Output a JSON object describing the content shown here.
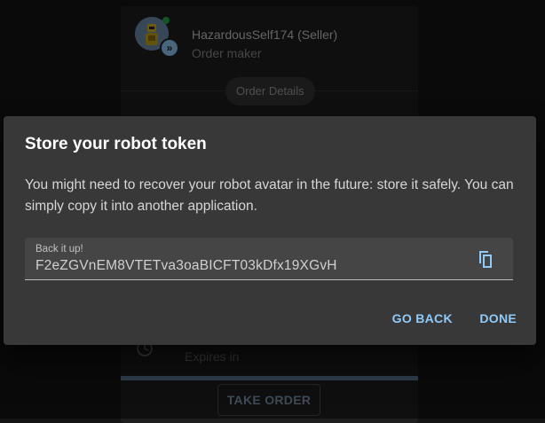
{
  "order": {
    "seller_name": "HazardousSelf174 (Seller)",
    "seller_role": "Order maker",
    "details_chip": "Order Details",
    "expires_label": "Expires in",
    "progress_fraction": 1.0,
    "take_order_label": "TAKE ORDER"
  },
  "dialog": {
    "title": "Store your robot token",
    "body": "You might need to recover your robot avatar in the future: store it safely. You can simply copy it into another application.",
    "token_field": {
      "label": "Back it up!",
      "value": "F2eZGVnEM8VTETva3oaBICFT03kDfx19XGvH"
    },
    "buttons": {
      "go_back": "GO BACK",
      "done": "DONE"
    }
  },
  "colors": {
    "accent": "#90caf9",
    "dialog_bg": "#383838",
    "panel_bg": "#1e1e1e"
  },
  "icons": {
    "copy": "copy-icon",
    "clock": "clock-icon",
    "avatar": "robot-avatar",
    "badge": "double-chevron-icon"
  }
}
